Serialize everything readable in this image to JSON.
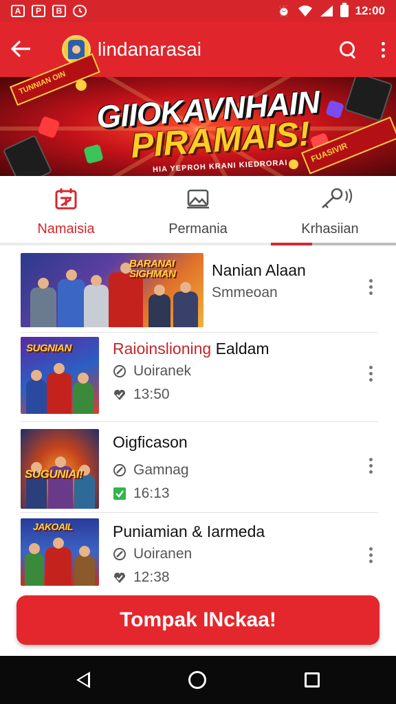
{
  "status_bar": {
    "icons_left": [
      "A",
      "P",
      "B",
      "clock-icon"
    ],
    "time": "12:00",
    "icons_right": [
      "alarm-icon",
      "wifi-icon",
      "signal-icon",
      "battery-icon"
    ]
  },
  "app_bar": {
    "back_icon": "arrow-left-icon",
    "title": "lindanarasai",
    "avatar": "avatar",
    "actions": [
      "search-icon",
      "more-vert-icon"
    ]
  },
  "banner": {
    "headline_line1": "GIIOKAVNHAIN",
    "headline_line2": "PIRAMAIS!",
    "tagline": "HIA YEPROH KRANI KIEDRORAI",
    "ribbon_left": "TUNNIAN OIN",
    "ribbon_right": "FUASIVIR"
  },
  "tabs": [
    {
      "label": "Namaisia",
      "icon": "calendar-icon",
      "active": true
    },
    {
      "label": "Permania",
      "icon": "image-icon",
      "active": false
    },
    {
      "label": "Krhasiian",
      "icon": "audio-key-icon",
      "active": false
    }
  ],
  "list": [
    {
      "title": "Nanian Alaan",
      "subtitle": "Smmeoan",
      "thumb_label": "BARANAI SIGHMAN"
    },
    {
      "title_highlight": "Raioinslioning",
      "title": "Ealdam",
      "meta1": "Uoiranek",
      "meta2": "13:50",
      "thumb_label": "SUGNIAN"
    },
    {
      "title": "Oigficason",
      "meta1": "Gamnag",
      "meta2": "16:13",
      "thumb_label": "SUGUNIAI!"
    },
    {
      "title": "Puniamian & Iarmeda",
      "meta1": "Uoiranen",
      "meta2": "12:38",
      "thumb_label": "JAKOAIL"
    }
  ],
  "cta_label": "Tompak INckaa!",
  "nav_bar": [
    "nav-back-icon",
    "nav-home-icon",
    "nav-recents-icon"
  ],
  "colors": {
    "brand_red": "#e0262c",
    "accent_yellow": "#ffcf26",
    "text_dark": "#111111",
    "text_muted": "#555555",
    "check_green": "#2fb64b"
  }
}
